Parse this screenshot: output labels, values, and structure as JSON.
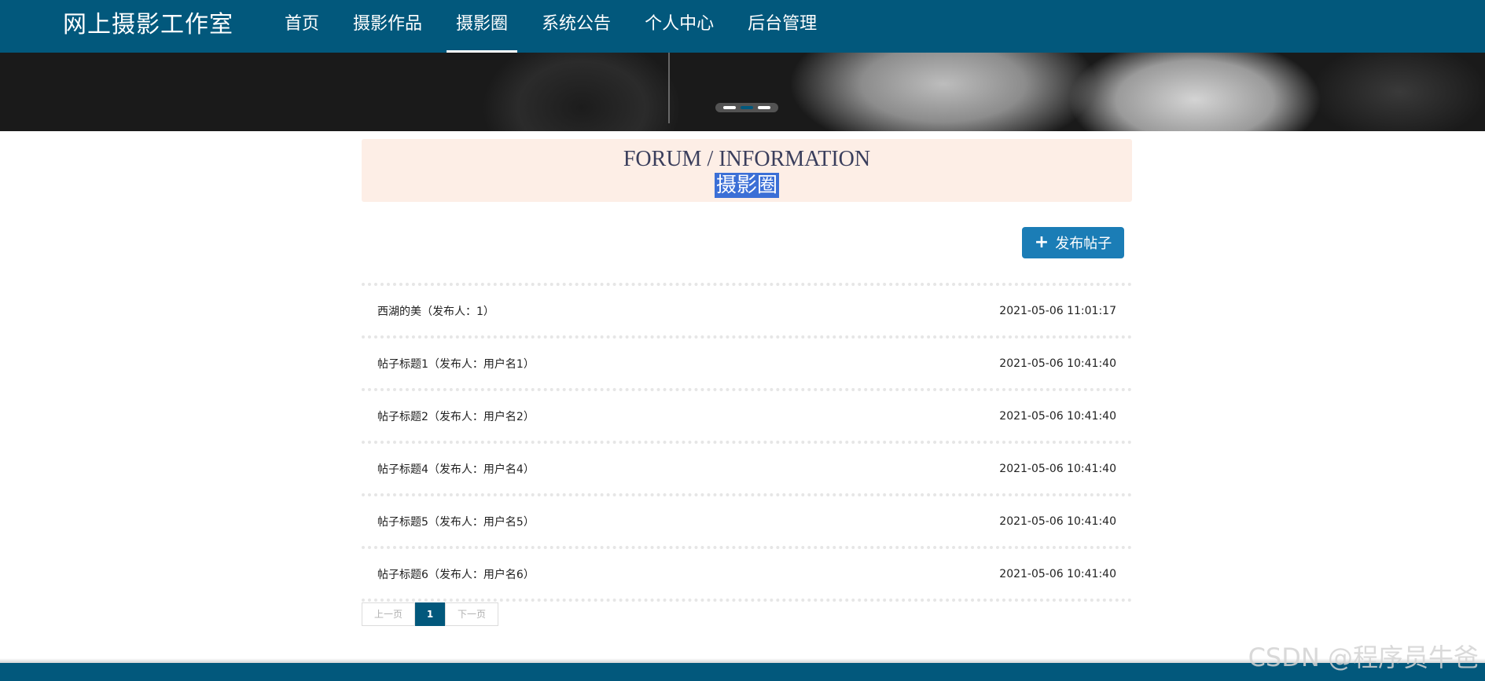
{
  "header": {
    "brand": "网上摄影工作室",
    "nav": [
      {
        "label": "首页",
        "active": false
      },
      {
        "label": "摄影作品",
        "active": false
      },
      {
        "label": "摄影圈",
        "active": true
      },
      {
        "label": "系统公告",
        "active": false
      },
      {
        "label": "个人中心",
        "active": false
      },
      {
        "label": "后台管理",
        "active": false
      }
    ]
  },
  "section": {
    "title_en": "FORUM / INFORMATION",
    "title_cn": "摄影圈"
  },
  "actions": {
    "publish_label": "发布帖子"
  },
  "posts": [
    {
      "title": "西湖的美（发布人：1）",
      "time": "2021-05-06 11:01:17"
    },
    {
      "title": "帖子标题1（发布人：用户名1）",
      "time": "2021-05-06 10:41:40"
    },
    {
      "title": "帖子标题2（发布人：用户名2）",
      "time": "2021-05-06 10:41:40"
    },
    {
      "title": "帖子标题4（发布人：用户名4）",
      "time": "2021-05-06 10:41:40"
    },
    {
      "title": "帖子标题5（发布人：用户名5）",
      "time": "2021-05-06 10:41:40"
    },
    {
      "title": "帖子标题6（发布人：用户名6）",
      "time": "2021-05-06 10:41:40"
    }
  ],
  "pagination": {
    "prev": "上一页",
    "current": "1",
    "next": "下一页"
  },
  "watermark": "CSDN @程序员牛爸",
  "colors": {
    "primary": "#02587c",
    "button": "#1b7db6",
    "title_bg": "#fdeee6"
  }
}
